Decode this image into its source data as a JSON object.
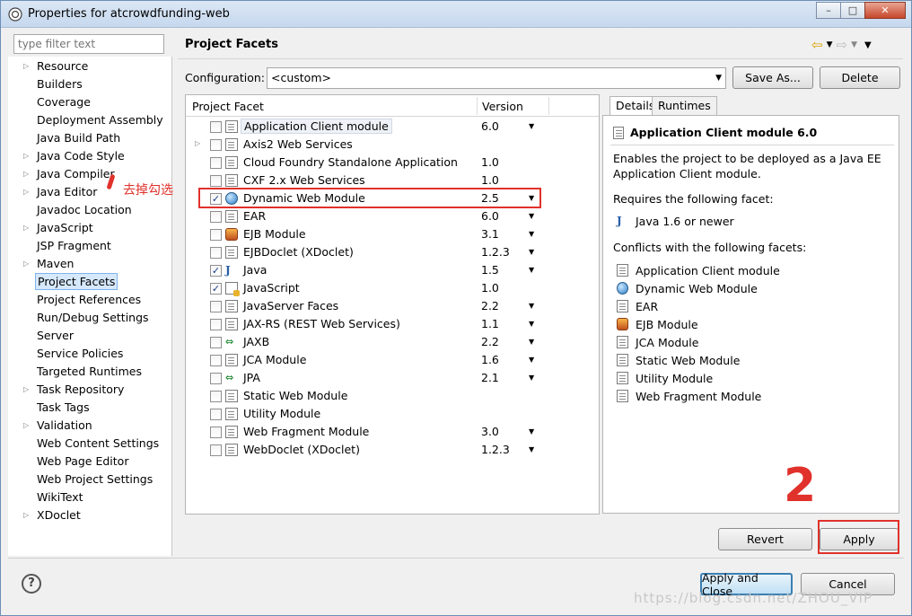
{
  "window": {
    "title": "Properties for atcrowdfunding-web",
    "controls": {
      "minimize": "–",
      "maximize": "□",
      "close": "✕"
    }
  },
  "sidebar": {
    "filter_placeholder": "type filter text",
    "items": [
      {
        "label": "Resource",
        "expandable": true
      },
      {
        "label": "Builders",
        "expandable": false
      },
      {
        "label": "Coverage",
        "expandable": false
      },
      {
        "label": "Deployment Assembly",
        "expandable": false
      },
      {
        "label": "Java Build Path",
        "expandable": false
      },
      {
        "label": "Java Code Style",
        "expandable": true
      },
      {
        "label": "Java Compiler",
        "expandable": true
      },
      {
        "label": "Java Editor",
        "expandable": true
      },
      {
        "label": "Javadoc Location",
        "expandable": false
      },
      {
        "label": "JavaScript",
        "expandable": true
      },
      {
        "label": "JSP Fragment",
        "expandable": false
      },
      {
        "label": "Maven",
        "expandable": true
      },
      {
        "label": "Project Facets",
        "expandable": false,
        "selected": true
      },
      {
        "label": "Project References",
        "expandable": false
      },
      {
        "label": "Run/Debug Settings",
        "expandable": false
      },
      {
        "label": "Server",
        "expandable": false
      },
      {
        "label": "Service Policies",
        "expandable": false
      },
      {
        "label": "Targeted Runtimes",
        "expandable": false
      },
      {
        "label": "Task Repository",
        "expandable": true
      },
      {
        "label": "Task Tags",
        "expandable": false
      },
      {
        "label": "Validation",
        "expandable": true
      },
      {
        "label": "Web Content Settings",
        "expandable": false
      },
      {
        "label": "Web Page Editor",
        "expandable": false
      },
      {
        "label": "Web Project Settings",
        "expandable": false
      },
      {
        "label": "WikiText",
        "expandable": false
      },
      {
        "label": "XDoclet",
        "expandable": true
      }
    ]
  },
  "annotations": {
    "uncheck_note": "去掉勾选",
    "step_number": "2",
    "watermark": "https://blog.csdn.net/ZHOU_VIP"
  },
  "main": {
    "title": "Project Facets",
    "configuration_label": "Configuration:",
    "configuration_value": "<custom>",
    "save_as": "Save As...",
    "delete": "Delete",
    "table": {
      "col_facet": "Project Facet",
      "col_version": "Version",
      "rows": [
        {
          "name": "Application Client module",
          "version": "6.0",
          "dropdown": true,
          "checked": false,
          "icon": "doc",
          "expandable": false,
          "boxed": true
        },
        {
          "name": "Axis2 Web Services",
          "version": "",
          "dropdown": false,
          "checked": false,
          "icon": "doc",
          "expandable": true
        },
        {
          "name": "Cloud Foundry Standalone Application",
          "version": "1.0",
          "dropdown": false,
          "checked": false,
          "icon": "doc",
          "expandable": false
        },
        {
          "name": "CXF 2.x Web Services",
          "version": "1.0",
          "dropdown": false,
          "checked": false,
          "icon": "doc",
          "expandable": false
        },
        {
          "name": "Dynamic Web Module",
          "version": "2.5",
          "dropdown": true,
          "checked": true,
          "icon": "globe",
          "expandable": false
        },
        {
          "name": "EAR",
          "version": "6.0",
          "dropdown": true,
          "checked": false,
          "icon": "doc",
          "expandable": false
        },
        {
          "name": "EJB Module",
          "version": "3.1",
          "dropdown": true,
          "checked": false,
          "icon": "bean",
          "expandable": false
        },
        {
          "name": "EJBDoclet (XDoclet)",
          "version": "1.2.3",
          "dropdown": true,
          "checked": false,
          "icon": "doc",
          "expandable": false
        },
        {
          "name": "Java",
          "version": "1.5",
          "dropdown": true,
          "checked": true,
          "icon": "java",
          "expandable": false
        },
        {
          "name": "JavaScript",
          "version": "1.0",
          "dropdown": false,
          "checked": true,
          "icon": "js",
          "expandable": false
        },
        {
          "name": "JavaServer Faces",
          "version": "2.2",
          "dropdown": true,
          "checked": false,
          "icon": "doc",
          "expandable": false
        },
        {
          "name": "JAX-RS (REST Web Services)",
          "version": "1.1",
          "dropdown": true,
          "checked": false,
          "icon": "doc",
          "expandable": false
        },
        {
          "name": "JAXB",
          "version": "2.2",
          "dropdown": true,
          "checked": false,
          "icon": "arrows",
          "expandable": false
        },
        {
          "name": "JCA Module",
          "version": "1.6",
          "dropdown": true,
          "checked": false,
          "icon": "doc",
          "expandable": false
        },
        {
          "name": "JPA",
          "version": "2.1",
          "dropdown": true,
          "checked": false,
          "icon": "arrows",
          "expandable": false
        },
        {
          "name": "Static Web Module",
          "version": "",
          "dropdown": false,
          "checked": false,
          "icon": "doc",
          "expandable": false
        },
        {
          "name": "Utility Module",
          "version": "",
          "dropdown": false,
          "checked": false,
          "icon": "doc",
          "expandable": false
        },
        {
          "name": "Web Fragment Module",
          "version": "3.0",
          "dropdown": true,
          "checked": false,
          "icon": "doc",
          "expandable": false
        },
        {
          "name": "WebDoclet (XDoclet)",
          "version": "1.2.3",
          "dropdown": true,
          "checked": false,
          "icon": "doc",
          "expandable": false
        }
      ]
    },
    "details": {
      "tab_details": "Details",
      "tab_runtimes": "Runtimes",
      "title": "Application Client module 6.0",
      "description": "Enables the project to be deployed as a Java EE Application Client module.",
      "requires_label": "Requires the following facet:",
      "requires": [
        {
          "label": "Java 1.6 or newer",
          "icon": "java"
        }
      ],
      "conflicts_label": "Conflicts with the following facets:",
      "conflicts": [
        {
          "label": "Application Client module",
          "icon": "doc"
        },
        {
          "label": "Dynamic Web Module",
          "icon": "globe"
        },
        {
          "label": "EAR",
          "icon": "doc"
        },
        {
          "label": "EJB Module",
          "icon": "bean"
        },
        {
          "label": "JCA Module",
          "icon": "doc"
        },
        {
          "label": "Static Web Module",
          "icon": "doc"
        },
        {
          "label": "Utility Module",
          "icon": "doc"
        },
        {
          "label": "Web Fragment Module",
          "icon": "doc"
        }
      ]
    },
    "revert": "Revert",
    "apply": "Apply"
  },
  "footer": {
    "help": "?",
    "apply_and_close": "Apply and Close",
    "cancel": "Cancel"
  }
}
